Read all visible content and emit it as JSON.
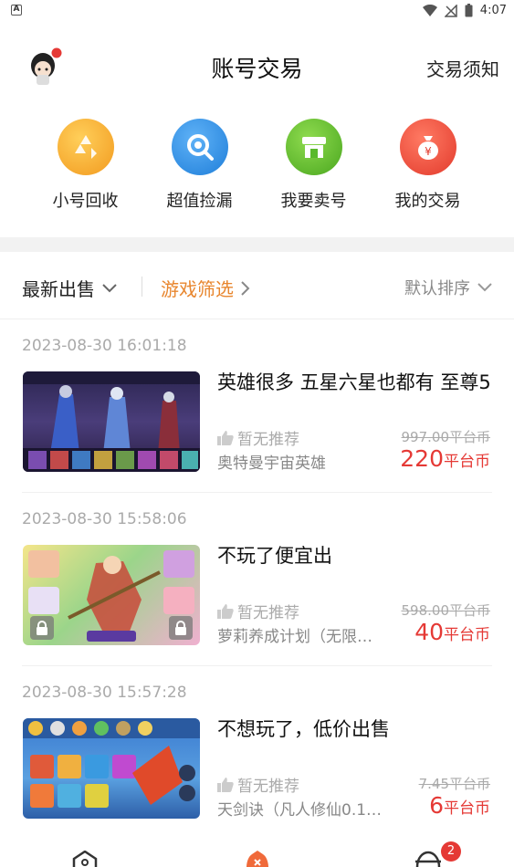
{
  "status_bar": {
    "time": "4:07",
    "left_icon": "A"
  },
  "header": {
    "title": "账号交易",
    "notice_link": "交易须知"
  },
  "shortcuts": [
    {
      "label": "小号回收",
      "icon": "recycle-icon",
      "color": "#f7a52a"
    },
    {
      "label": "超值捡漏",
      "icon": "magnifier-icon",
      "color": "#2f8de4"
    },
    {
      "label": "我要卖号",
      "icon": "shop-icon",
      "color": "#5ab92c"
    },
    {
      "label": "我的交易",
      "icon": "money-bag-icon",
      "color": "#ee4b3b"
    }
  ],
  "filters": {
    "latest": "最新出售",
    "game_filter": "游戏筛选",
    "sort": "默认排序"
  },
  "listings": [
    {
      "time": "2023-08-30 16:01:18",
      "title": "英雄很多 五星六星也都有 至尊5",
      "recommend": "暂无推荐",
      "original_price": "997.00平台币",
      "game": "奥特曼宇宙英雄",
      "price": "220",
      "unit": "平台币"
    },
    {
      "time": "2023-08-30 15:58:06",
      "title": "不玩了便宜出",
      "recommend": "暂无推荐",
      "original_price": "598.00平台币",
      "game": "萝莉养成计划（无限…",
      "price": "40",
      "unit": "平台币"
    },
    {
      "time": "2023-08-30 15:57:28",
      "title": "不想玩了，低价出售",
      "recommend": "暂无推荐",
      "original_price": "7.45平台币",
      "game": "天剑诀（凡人修仙0.1折…",
      "price": "6",
      "unit": "平台币"
    }
  ],
  "tabbar": {
    "badge_count": "2"
  },
  "colors": {
    "accent": "#e8862e",
    "price": "#e53935"
  }
}
